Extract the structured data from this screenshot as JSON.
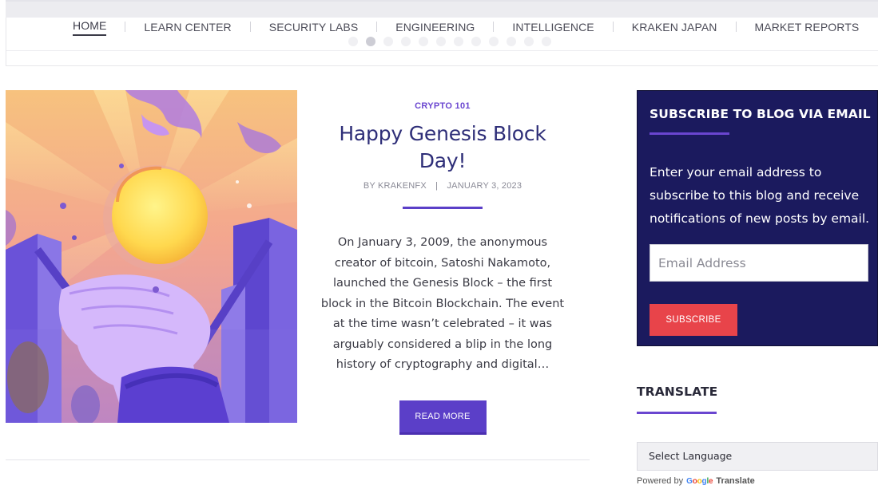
{
  "nav": {
    "items": [
      {
        "label": "HOME",
        "active": true
      },
      {
        "label": "LEARN CENTER"
      },
      {
        "label": "SECURITY LABS"
      },
      {
        "label": "ENGINEERING"
      },
      {
        "label": "INTELLIGENCE"
      },
      {
        "label": "KRAKEN JAPAN"
      },
      {
        "label": "MARKET REPORTS"
      }
    ],
    "slider_dots": 12,
    "active_dot": 2
  },
  "post": {
    "category": "CRYPTO 101",
    "title": "Happy Genesis Block Day!",
    "by": "BY",
    "author": "KRAKENFX",
    "separator": "|",
    "date": "JANUARY 3, 2023",
    "excerpt": "On January 3, 2009, the anonymous creator of bitcoin, Satoshi Nakamoto, launched the Genesis Block – the first block in the Bitcoin Blockchain. The event at the time wasn’t celebrated – it was arguably considered a blip in the long history of cryptography and digital…",
    "read_more": "READ MORE"
  },
  "subscribe": {
    "title": "SUBSCRIBE TO BLOG VIA EMAIL",
    "text": "Enter your email address to subscribe to this blog and receive notifications of new posts by email.",
    "email_placeholder": "Email Address",
    "button": "SUBSCRIBE"
  },
  "translate": {
    "title": "TRANSLATE",
    "select_value": "Select Language",
    "powered_by": "Powered by",
    "google": "Google",
    "translate_link": "Translate"
  },
  "colors": {
    "accent": "#5b3fc8",
    "navy": "#1b1a5e",
    "subscribe_button": "#e8444a",
    "title": "#2e2e78"
  }
}
